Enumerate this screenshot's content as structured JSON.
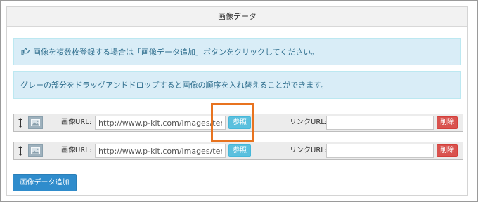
{
  "panel": {
    "title": "画像データ"
  },
  "alerts": {
    "info_1": "画像を複数枚登録する場合は「画像データ追加」ボタンをクリックしてください。",
    "info_2": "グレーの部分をドラッグアンドドロップすると画像の順序を入れ替えることができます。",
    "hand_icon": "hand-pointing-right-icon"
  },
  "rows": [
    {
      "image_url_label": "画像URL:",
      "image_url_value": "http://www.p-kit.com/images/templ",
      "ref_button": "参照",
      "link_url_label": "リンクURL:",
      "link_url_value": "",
      "delete_button": "削除"
    },
    {
      "image_url_label": "画像URL:",
      "image_url_value": "http://www.p-kit.com/images/templ",
      "ref_button": "参照",
      "link_url_label": "リンクURL:",
      "link_url_value": "",
      "delete_button": "削除"
    }
  ],
  "actions": {
    "add_button": "画像データ追加"
  },
  "colors": {
    "info_bg": "#d9edf7",
    "ref_button": "#5bc0de",
    "delete_button": "#d9534f",
    "add_button": "#2f8ccc",
    "highlight": "#e8731f"
  }
}
